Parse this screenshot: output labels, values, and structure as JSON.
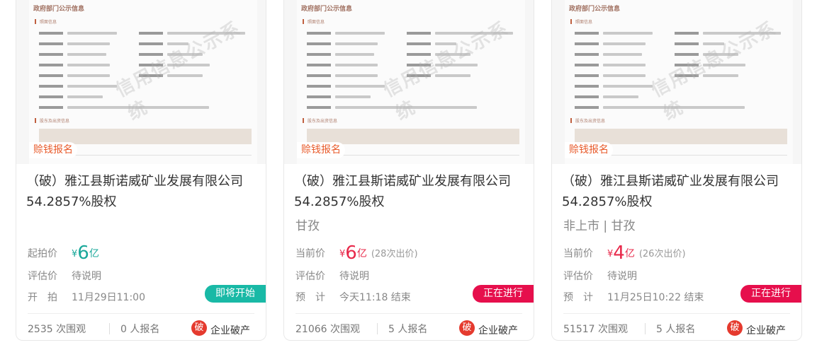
{
  "cards": [
    {
      "thumb": {
        "doc_title": "政府部门公示信息",
        "sec1": "照面信息",
        "sec2": "股东及出资信息",
        "watermark": "信用信息公示系统"
      },
      "tag": "赊钱报名",
      "title": "（破）雅江县斯诺威矿业发展有限公司54.2857%股权",
      "region": "",
      "price_label": "起拍价",
      "price_symbol": "¥",
      "price_value": "6",
      "price_unit": "亿",
      "bid_count": "",
      "eval_label": "评估价",
      "eval_value": "待说明",
      "time_label": "开　拍",
      "time_value": "11月29日11:00",
      "status": "即将开始",
      "status_color": "#19b9a6",
      "views": "2535 次围观",
      "signups": "0 人报名",
      "seal_char": "破",
      "category": "企业破产"
    },
    {
      "thumb": {
        "doc_title": "政府部门公示信息",
        "sec1": "照面信息",
        "sec2": "股东及出资信息",
        "watermark": "信用信息公示系统"
      },
      "tag": "赊钱报名",
      "title": "（破）雅江县斯诺威矿业发展有限公司54.2857%股权",
      "region": "甘孜",
      "price_label": "当前价",
      "price_symbol": "¥",
      "price_value": "6",
      "price_unit": "亿",
      "bid_count": "(28次出价)",
      "eval_label": "评估价",
      "eval_value": "待说明",
      "time_label": "预　计",
      "time_value": "今天11:18 结束",
      "status": "正在进行",
      "status_color": "#e60f4c",
      "views": "21066 次围观",
      "signups": "5 人报名",
      "seal_char": "破",
      "category": "企业破产"
    },
    {
      "thumb": {
        "doc_title": "政府部门公示信息",
        "sec1": "照面信息",
        "sec2": "股东及出资信息",
        "watermark": "信用信息公示系统"
      },
      "tag": "赊钱报名",
      "title": "（破）雅江县斯诺威矿业发展有限公司54.2857%股权",
      "region": "非上市 | 甘孜",
      "price_label": "当前价",
      "price_symbol": "¥",
      "price_value": "4",
      "price_unit": "亿",
      "bid_count": "(26次出价)",
      "eval_label": "评估价",
      "eval_value": "待说明",
      "time_label": "预　计",
      "time_value": "11月25日10:22 结束",
      "status": "正在进行",
      "status_color": "#e60f4c",
      "views": "51517 次围观",
      "signups": "5 人报名",
      "seal_char": "破",
      "category": "企业破产"
    }
  ]
}
